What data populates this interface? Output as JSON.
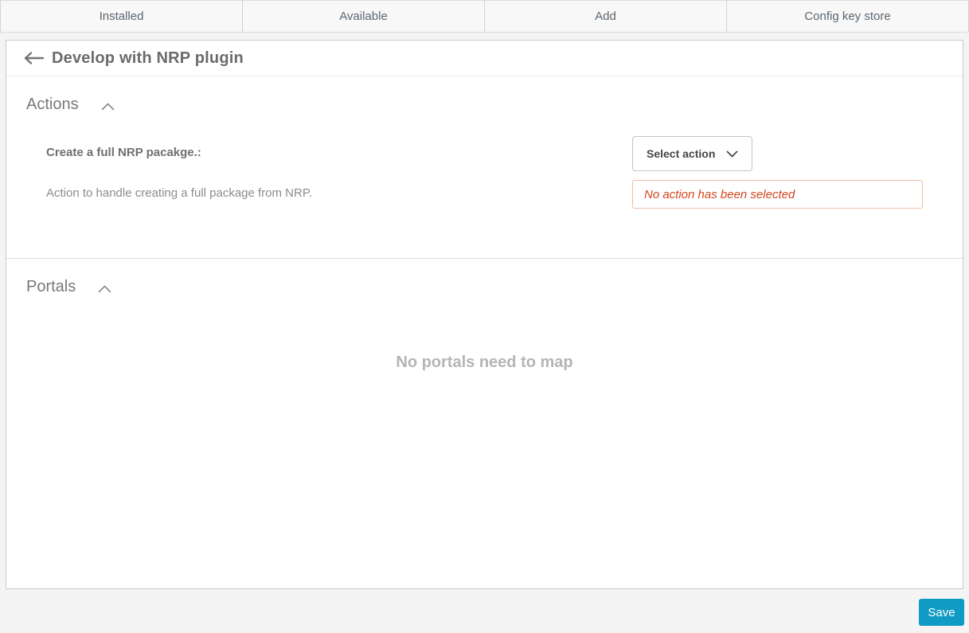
{
  "tabs": [
    {
      "label": "Installed"
    },
    {
      "label": "Available"
    },
    {
      "label": "Add"
    },
    {
      "label": "Config key store"
    }
  ],
  "header": {
    "title": "Develop with NRP plugin"
  },
  "actions_section": {
    "title": "Actions",
    "field": {
      "label": "Create a full NRP pacakge.:",
      "description": "Action to handle creating a full package from NRP.",
      "dropdown_label": "Select action",
      "error_message": "No action has been selected"
    }
  },
  "portals_section": {
    "title": "Portals",
    "empty_message": "No portals need to map"
  },
  "footer": {
    "save_label": "Save"
  },
  "colors": {
    "accent": "#0f9bc4",
    "error_text": "#d2451e",
    "error_border": "#f0bfa3",
    "panel_border": "#c8c8c8",
    "tab_text": "#5c6670"
  }
}
